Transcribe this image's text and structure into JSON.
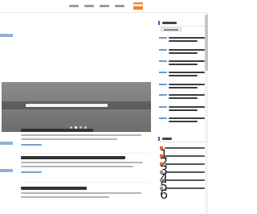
{
  "nav": {
    "items": [
      {
        "label": "",
        "active": false
      },
      {
        "label": "",
        "active": false
      },
      {
        "label": "",
        "active": false
      },
      {
        "label": "",
        "active": false
      },
      {
        "label": "",
        "active": true
      }
    ],
    "active_color": "#f58220"
  },
  "hero": {
    "caption": "",
    "slide_count": 4,
    "active_slide": 1
  },
  "articles": [
    {
      "title": "",
      "summary": "",
      "date": ""
    },
    {
      "title": "",
      "summary": "",
      "date": ""
    },
    {
      "title": "",
      "summary": "",
      "date": ""
    }
  ],
  "sidebar": {
    "news_heading": "",
    "subscribe_label": "",
    "news": [
      {
        "time": "",
        "text": ""
      },
      {
        "time": "",
        "text": ""
      },
      {
        "time": "",
        "text": ""
      },
      {
        "time": "",
        "text": ""
      },
      {
        "time": "",
        "text": ""
      },
      {
        "time": "",
        "text": ""
      },
      {
        "time": "",
        "text": ""
      },
      {
        "time": "",
        "text": ""
      }
    ],
    "hot_heading": "",
    "hot": [
      {
        "rank": "1",
        "text": ""
      },
      {
        "rank": "2",
        "text": ""
      },
      {
        "rank": "3",
        "text": ""
      },
      {
        "rank": "4",
        "text": ""
      },
      {
        "rank": "5",
        "text": ""
      },
      {
        "rank": "6",
        "text": ""
      }
    ]
  },
  "colors": {
    "accent": "#f58220",
    "link_blue": "#2f66b3",
    "date_blue": "#7d9fc8"
  }
}
